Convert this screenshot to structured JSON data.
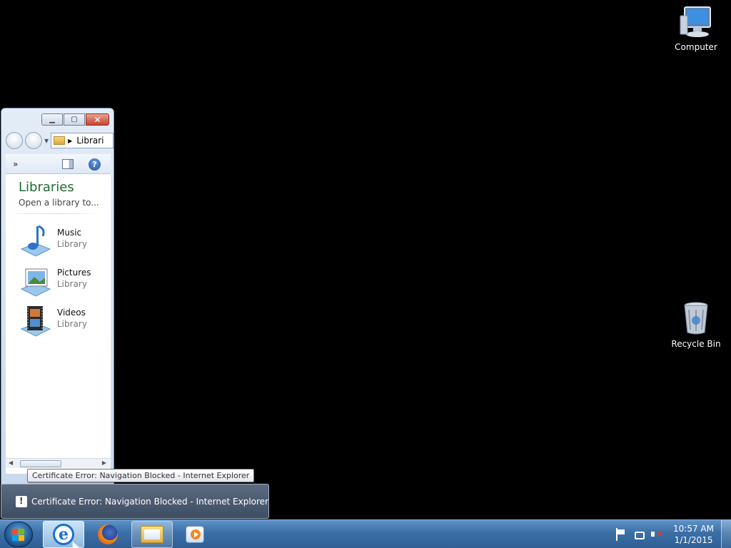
{
  "desktop": {
    "icons": [
      {
        "label": "Computer",
        "icon": "computer-icon"
      },
      {
        "label": "Recycle Bin",
        "icon": "recycle-bin-icon"
      }
    ]
  },
  "explorer": {
    "address": "Librari",
    "command_more": "»",
    "help_glyph": "?",
    "heading": "Libraries",
    "subheading": "Open a library to...",
    "items": [
      {
        "name": "Music",
        "type": "Library",
        "icon": "music-library-icon"
      },
      {
        "name": "Pictures",
        "type": "Library",
        "icon": "pictures-library-icon"
      },
      {
        "name": "Videos",
        "type": "Library",
        "icon": "videos-library-icon"
      }
    ]
  },
  "tooltip": {
    "text": "Certificate Error: Navigation Blocked - Internet Explorer"
  },
  "thumbnail_popup": {
    "title": "Certificate Error: Navigation Blocked - Internet Explorer"
  },
  "taskbar": {
    "buttons": [
      {
        "name": "Internet Explorer",
        "icon": "internet-explorer-icon",
        "glyph": "e"
      },
      {
        "name": "Firefox",
        "icon": "firefox-icon"
      },
      {
        "name": "Windows Explorer",
        "icon": "windows-explorer-icon"
      },
      {
        "name": "Windows Media Player",
        "icon": "media-player-icon"
      }
    ],
    "clock": {
      "time": "10:57 AM",
      "date": "1/1/2015"
    }
  },
  "colors": {
    "accent_heading": "#1e6b2f",
    "taskbar": "#3b6fa6",
    "close_button": "#c7452e"
  }
}
